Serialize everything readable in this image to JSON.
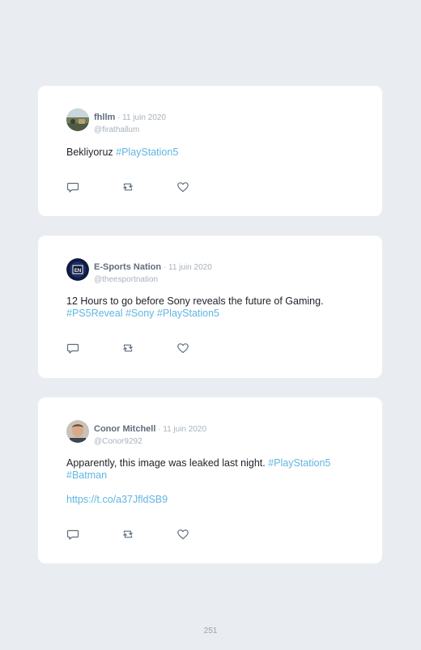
{
  "tweets": [
    {
      "name": "fhllm",
      "date": " · 11 juin 2020",
      "handle": "@firathallum",
      "text": "Bekliyoruz ",
      "tags": "#PlayStation5"
    },
    {
      "name": "E-Sports Nation",
      "date": " · 11 juin 2020",
      "handle": "@theesportnation",
      "text": "12 Hours to go before Sony reveals the future of Gaming.",
      "tags": "#PS5Reveal #Sony #PlayStation5"
    },
    {
      "name": "Conor Mitchell",
      "date": " · 11 juin 2020",
      "handle": "@Conor9292",
      "text": "Apparently, this image was leaked last night. ",
      "tag1": "#PlayStation5",
      "tag2": "#Batman",
      "link": "https://t.co/a37JfldSB9"
    }
  ],
  "icons": [
    "reply-icon",
    "retweet-icon",
    "like-icon"
  ],
  "page_number": "251"
}
